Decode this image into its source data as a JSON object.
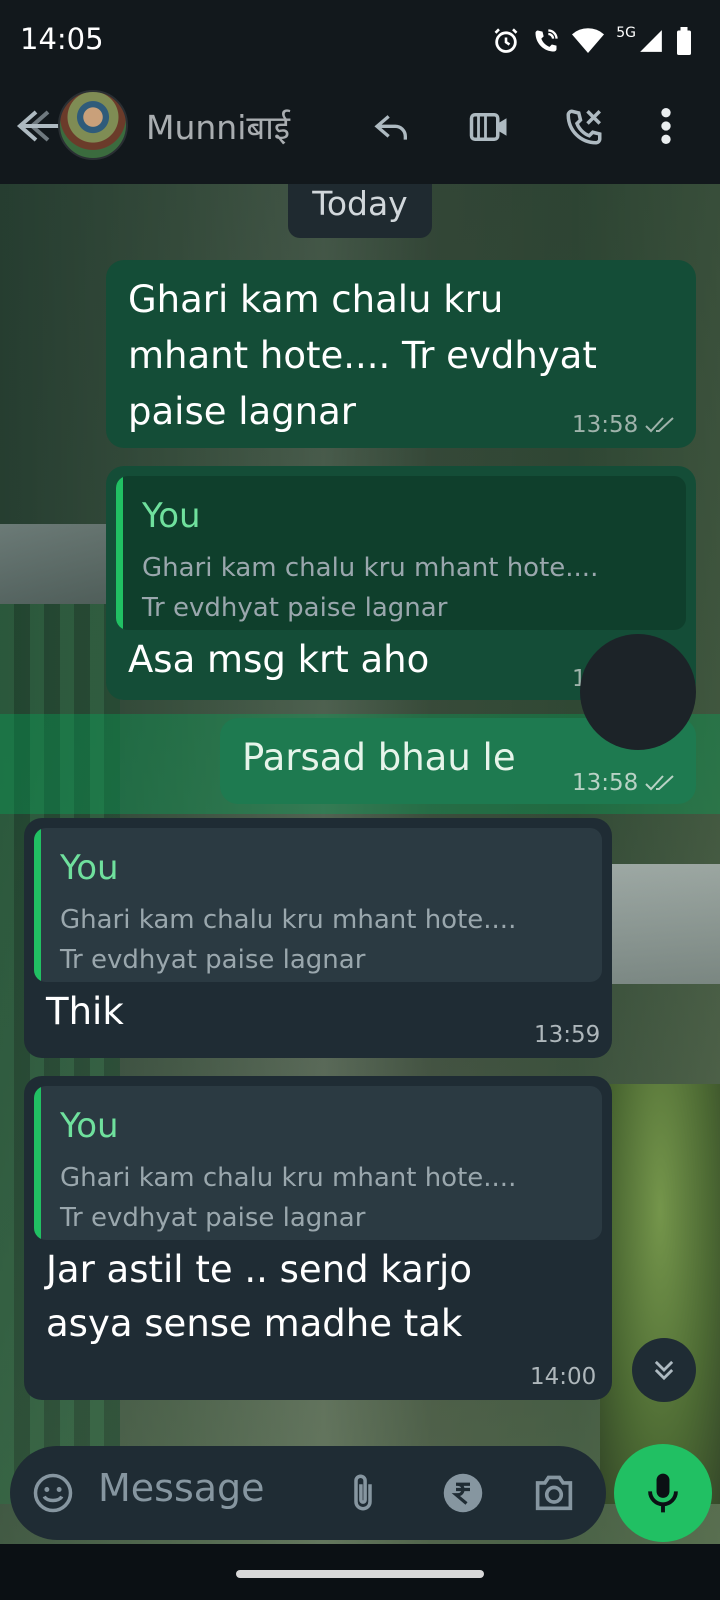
{
  "status_bar": {
    "time": "14:05",
    "network_label": "5G"
  },
  "header": {
    "contact_name": "Munniबाई"
  },
  "chat": {
    "date_chip": "Today",
    "messages": [
      {
        "direction": "outgoing",
        "text_line1": "Ghari kam chalu kru",
        "text_line2": "mhant hote.... Tr evdhyat",
        "text_line3": "paise lagnar",
        "time": "13:58",
        "read": true
      },
      {
        "direction": "outgoing",
        "quote_author": "You",
        "quote_text": "Ghari kam chalu kru mhant hote....\nTr evdhyat paise lagnar",
        "text": "Asa msg krt aho",
        "time": "13:58"
      },
      {
        "direction": "outgoing",
        "text": "Parsad bhau le",
        "time": "13:58",
        "read": true,
        "selected": true
      },
      {
        "direction": "incoming",
        "quote_author": "You",
        "quote_text": "Ghari kam chalu kru mhant hote....\nTr evdhyat paise lagnar",
        "text": "Thik",
        "time": "13:59"
      },
      {
        "direction": "incoming",
        "quote_author": "You",
        "quote_text": "Ghari kam chalu kru mhant hote....\nTr evdhyat paise lagnar",
        "text_line1": "Jar astil te .. send karjo",
        "text_line2": "asya sense madhe tak",
        "time": "14:00"
      }
    ]
  },
  "input": {
    "placeholder": "Message"
  },
  "colors": {
    "outgoing_bubble": "#144d37",
    "incoming_bubble": "#1f2c34",
    "accent_green": "#21c063",
    "header_bg": "#12181c"
  },
  "icons": [
    "back-arrow-icon",
    "reply-icon",
    "video-icon",
    "call-icon",
    "more-icon",
    "alarm-icon",
    "wifi-call-icon",
    "wifi-icon",
    "signal-icon",
    "battery-icon",
    "double-check-icon",
    "chevron-double-down-icon",
    "emoji-icon",
    "attach-icon",
    "rupee-icon",
    "camera-icon",
    "mic-icon"
  ]
}
